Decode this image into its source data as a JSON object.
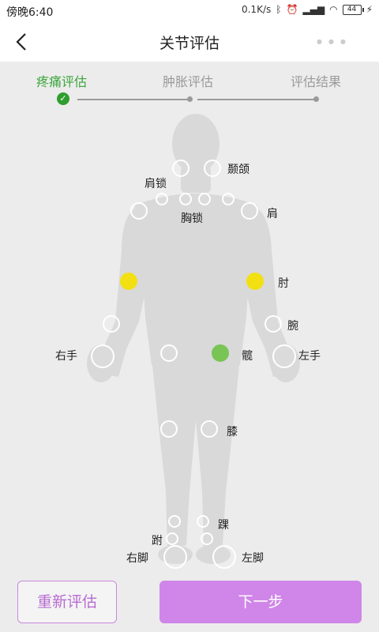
{
  "status_bar": {
    "time": "傍晚6:40",
    "network_speed": "0.1K/s",
    "battery": "44"
  },
  "header": {
    "title": "关节评估"
  },
  "steps": [
    {
      "label": "疼痛评估",
      "state": "active"
    },
    {
      "label": "肿胀评估",
      "state": "pending"
    },
    {
      "label": "评估结果",
      "state": "pending"
    }
  ],
  "labels": {
    "jaw": "颞颌",
    "shoulder_clavicle": "肩锁",
    "sternoclavicular": "胸锁",
    "shoulder": "肩",
    "elbow": "肘",
    "wrist": "腕",
    "right_hand": "右手",
    "hip": "髋",
    "left_hand": "左手",
    "knee": "膝",
    "ankle": "踝",
    "toe": "跗",
    "right_foot": "右脚",
    "left_foot": "左脚"
  },
  "joint_status": {
    "right_elbow": "yellow",
    "left_elbow": "yellow",
    "left_hip": "green"
  },
  "colors": {
    "active": "#3aa53a",
    "accent": "#cf86e8",
    "yellow": "#f2e012",
    "green": "#78c556"
  },
  "buttons": {
    "reset": "重新评估",
    "next": "下一步"
  }
}
